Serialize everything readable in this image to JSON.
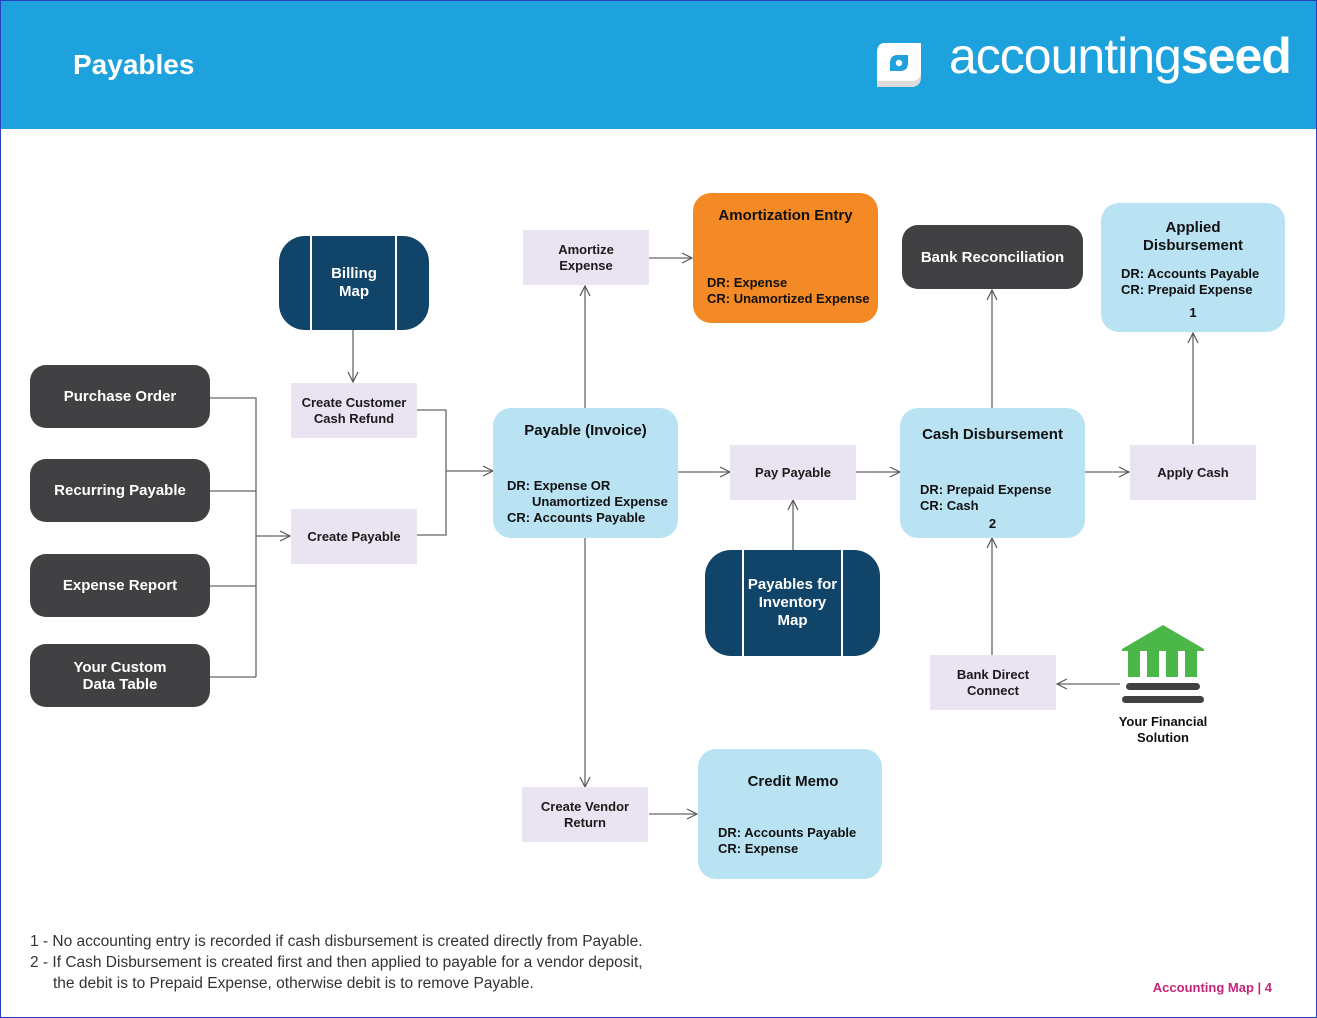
{
  "header": {
    "title": "Payables",
    "logo": {
      "icon": "seed-logo-icon",
      "text_light": "accounting",
      "text_bold": "seed"
    }
  },
  "colors": {
    "header_bg": "#1ea2dd",
    "dark_node": "#414042",
    "navy_map": "#114469",
    "action_box": "#e9e3f2",
    "entry_blue": "#b9e3f3",
    "entry_orange": "#f48a25",
    "bank_green": "#4bb748",
    "footer_pink": "#c4257a"
  },
  "sources": [
    {
      "label": "Purchase Order"
    },
    {
      "label": "Recurring Payable"
    },
    {
      "label": "Expense Report"
    },
    {
      "label": "Your Custom Data Table"
    }
  ],
  "maps": {
    "billing": {
      "line1": "Billing",
      "line2": "Map"
    },
    "inventory": {
      "line1": "Payables for",
      "line2": "Inventory",
      "line3": "Map"
    }
  },
  "actions": {
    "create_customer_cash_refund": {
      "line1": "Create Customer",
      "line2": "Cash Refund"
    },
    "create_payable": {
      "label": "Create Payable"
    },
    "amortize_expense": {
      "line1": "Amortize",
      "line2": "Expense"
    },
    "pay_payable": {
      "label": "Pay Payable"
    },
    "apply_cash": {
      "label": "Apply Cash"
    },
    "create_vendor_return": {
      "line1": "Create Vendor",
      "line2": "Return"
    },
    "bank_direct_connect": {
      "line1": "Bank Direct",
      "line2": "Connect"
    }
  },
  "entries": {
    "payable_invoice": {
      "title": "Payable (Invoice)",
      "lines": [
        "DR: Expense OR",
        "Unamortized Expense",
        "CR: Accounts Payable"
      ]
    },
    "amortization_entry": {
      "title": "Amortization Entry",
      "lines": [
        "DR: Expense",
        "CR: Unamortized Expense"
      ]
    },
    "cash_disbursement": {
      "title": "Cash Disbursement",
      "lines": [
        "DR: Prepaid Expense",
        "CR: Cash"
      ],
      "note": "2"
    },
    "applied_disbursement": {
      "title_line1": "Applied",
      "title_line2": "Disbursement",
      "lines": [
        "DR: Accounts Payable",
        "CR: Prepaid Expense"
      ],
      "note": "1"
    },
    "credit_memo": {
      "title": "Credit Memo",
      "lines": [
        "DR: Accounts Payable",
        "CR: Expense"
      ]
    }
  },
  "bank_reconciliation": {
    "label": "Bank Reconciliation"
  },
  "financial_solution": {
    "icon": "bank-icon",
    "line1": "Your Financial",
    "line2": "Solution"
  },
  "footnotes": [
    "1 - No accounting entry is recorded if cash disbursement is created directly from Payable.",
    "2 - If Cash Disbursement is created first and then applied to payable for a vendor deposit,",
    "the debit is to Prepaid Expense, otherwise debit is to remove Payable."
  ],
  "footer": {
    "label": "Accounting Map | 4"
  }
}
